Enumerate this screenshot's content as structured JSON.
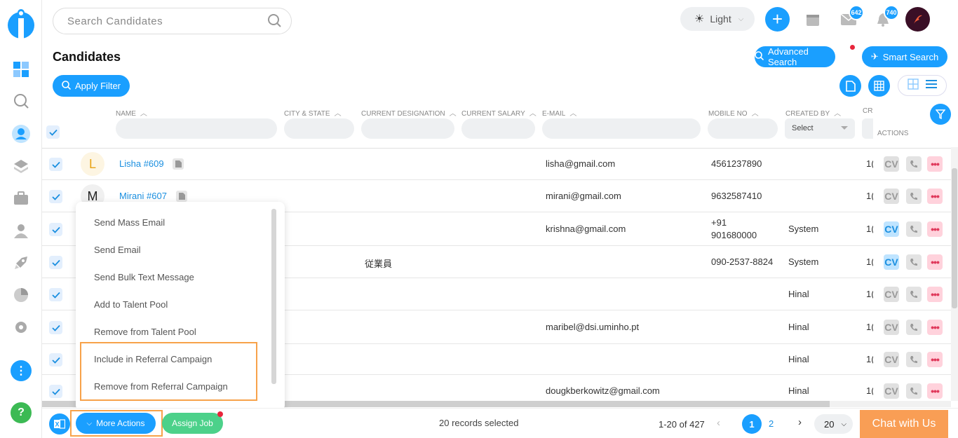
{
  "search": {
    "placeholder": "Search Candidates"
  },
  "theme": {
    "label": "Light"
  },
  "badges": {
    "mail": "642",
    "bell": "740"
  },
  "page_title": "Candidates",
  "buttons": {
    "advanced_search": "Advanced Search",
    "smart_search": "Smart Search",
    "apply_filter": "Apply Filter",
    "more_actions": "More Actions",
    "assign_job": "Assign Job",
    "chat": "Chat with Us"
  },
  "columns": {
    "name": "NAME",
    "city": "CITY & STATE",
    "designation": "CURRENT DESIGNATION",
    "salary": "CURRENT SALARY",
    "email": "E-MAIL",
    "mobile": "MOBILE NO",
    "created_by": "CREATED BY",
    "cr": "CRI",
    "actions": "ACTIONS"
  },
  "created_by_select": "Select",
  "rows": [
    {
      "initial": "L",
      "name": "Lisha #609",
      "designation": "",
      "email": "lisha@gmail.com",
      "mobile": "4561237890",
      "mobile2": "",
      "created_by": "",
      "cr": "1(",
      "cv_active": false
    },
    {
      "initial": "M",
      "name": "Mirani #607",
      "designation": "",
      "email": "mirani@gmail.com",
      "mobile": "9632587410",
      "mobile2": "",
      "created_by": "",
      "cr": "1(",
      "cv_active": false
    },
    {
      "initial": "",
      "name": "",
      "designation": "",
      "email": "krishna@gmail.com",
      "mobile": "+91",
      "mobile2": "901680000",
      "created_by": "System",
      "cr": "1(",
      "cv_active": true
    },
    {
      "initial": "",
      "name": "",
      "designation": "従業員",
      "email": "",
      "mobile": "090-2537-8824",
      "mobile2": "",
      "created_by": "System",
      "cr": "1(",
      "cv_active": true
    },
    {
      "initial": "",
      "name": "",
      "designation": "",
      "email": "",
      "mobile": "",
      "mobile2": "",
      "created_by": "Hinal",
      "cr": "1(",
      "cv_active": false
    },
    {
      "initial": "",
      "name": "",
      "designation": "",
      "email": "maribel@dsi.uminho.pt",
      "mobile": "",
      "mobile2": "",
      "created_by": "Hinal",
      "cr": "1(",
      "cv_active": false
    },
    {
      "initial": "",
      "name": "",
      "designation": "",
      "email": "",
      "mobile": "",
      "mobile2": "",
      "created_by": "Hinal",
      "cr": "1(",
      "cv_active": false
    },
    {
      "initial": "",
      "name": "",
      "designation": "",
      "email": "dougkberkowitz@gmail.com",
      "mobile": "",
      "mobile2": "",
      "created_by": "Hinal",
      "cr": "1(",
      "cv_active": false
    }
  ],
  "action_labels": {
    "cv": "CV",
    "more": "•••"
  },
  "menu": {
    "items": [
      "Send Mass Email",
      "Send Email",
      "Send Bulk Text Message",
      "Add to Talent Pool",
      "Remove from Talent Pool",
      "Include in Referral Campaign",
      "Remove from Referral Campaign"
    ]
  },
  "footer": {
    "selected": "20 records selected",
    "range": "1-20 of 427",
    "page1": "1",
    "page2": "2",
    "per_page": "20"
  },
  "colors": {
    "accent": "#1a9fff",
    "highlight": "#f7a24a",
    "chat": "#f99e55"
  }
}
